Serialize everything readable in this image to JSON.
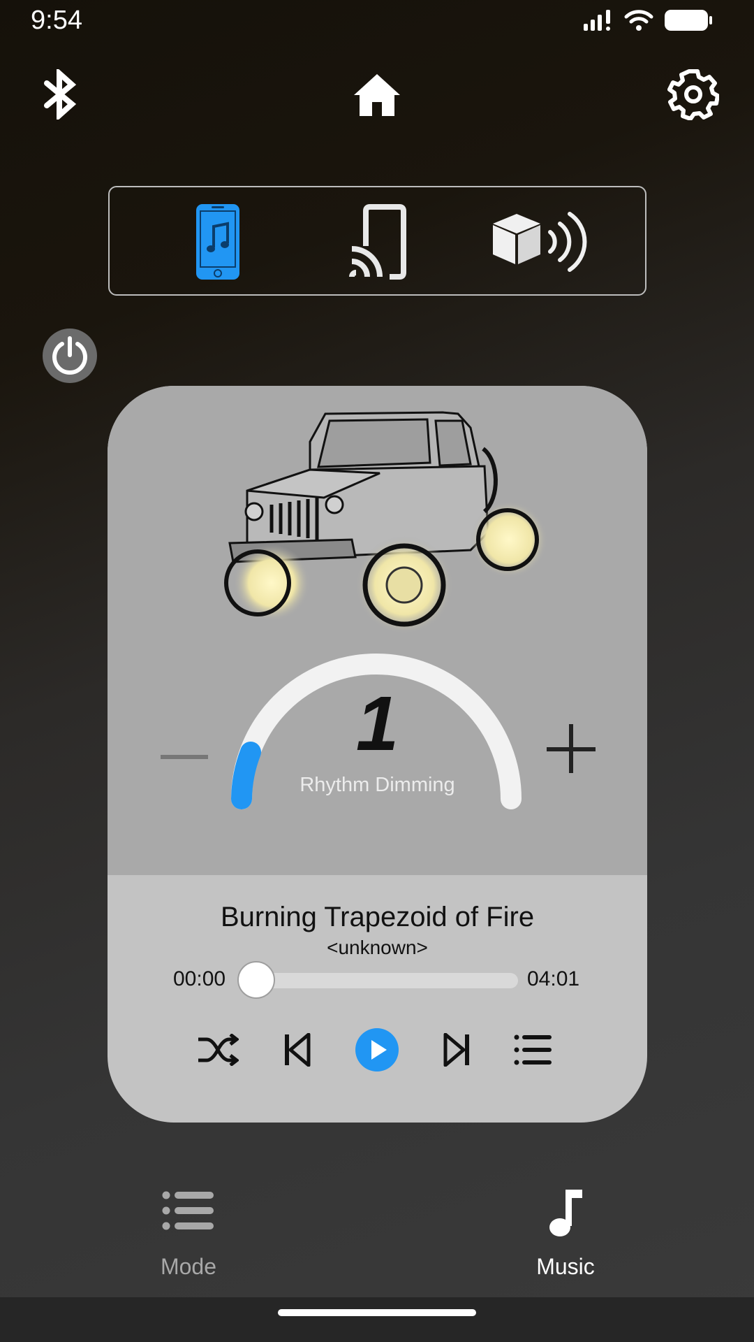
{
  "status_bar": {
    "time": "9:54"
  },
  "top_nav": {
    "bluetooth_icon": "bluetooth-icon",
    "home_icon": "home-icon",
    "settings_icon": "gear-icon"
  },
  "source_selector": {
    "options": [
      "phone-music-icon",
      "cast-icon",
      "speaker-icon"
    ],
    "selected": "phone-music-icon",
    "accent_color": "#2196f3"
  },
  "power": {
    "icon": "power-icon"
  },
  "rhythm": {
    "value": "1",
    "label": "Rhythm Dimming",
    "level_fraction": 0.1
  },
  "player": {
    "title": "Burning Trapezoid of Fire",
    "artist": "<unknown>",
    "current_time": "00:00",
    "total_time": "04:01",
    "progress_fraction": 0.0,
    "controls": [
      "shuffle-icon",
      "previous-icon",
      "play-icon",
      "next-icon",
      "playlist-icon"
    ]
  },
  "bottom_nav": {
    "tabs": [
      {
        "label": "Mode",
        "icon": "list-icon",
        "active": false
      },
      {
        "label": "Music",
        "icon": "music-note-icon",
        "active": true
      }
    ]
  },
  "colors": {
    "accent": "#2196f3",
    "active_tab": "#ffffff",
    "inactive_tab": "#a8a8a8"
  }
}
